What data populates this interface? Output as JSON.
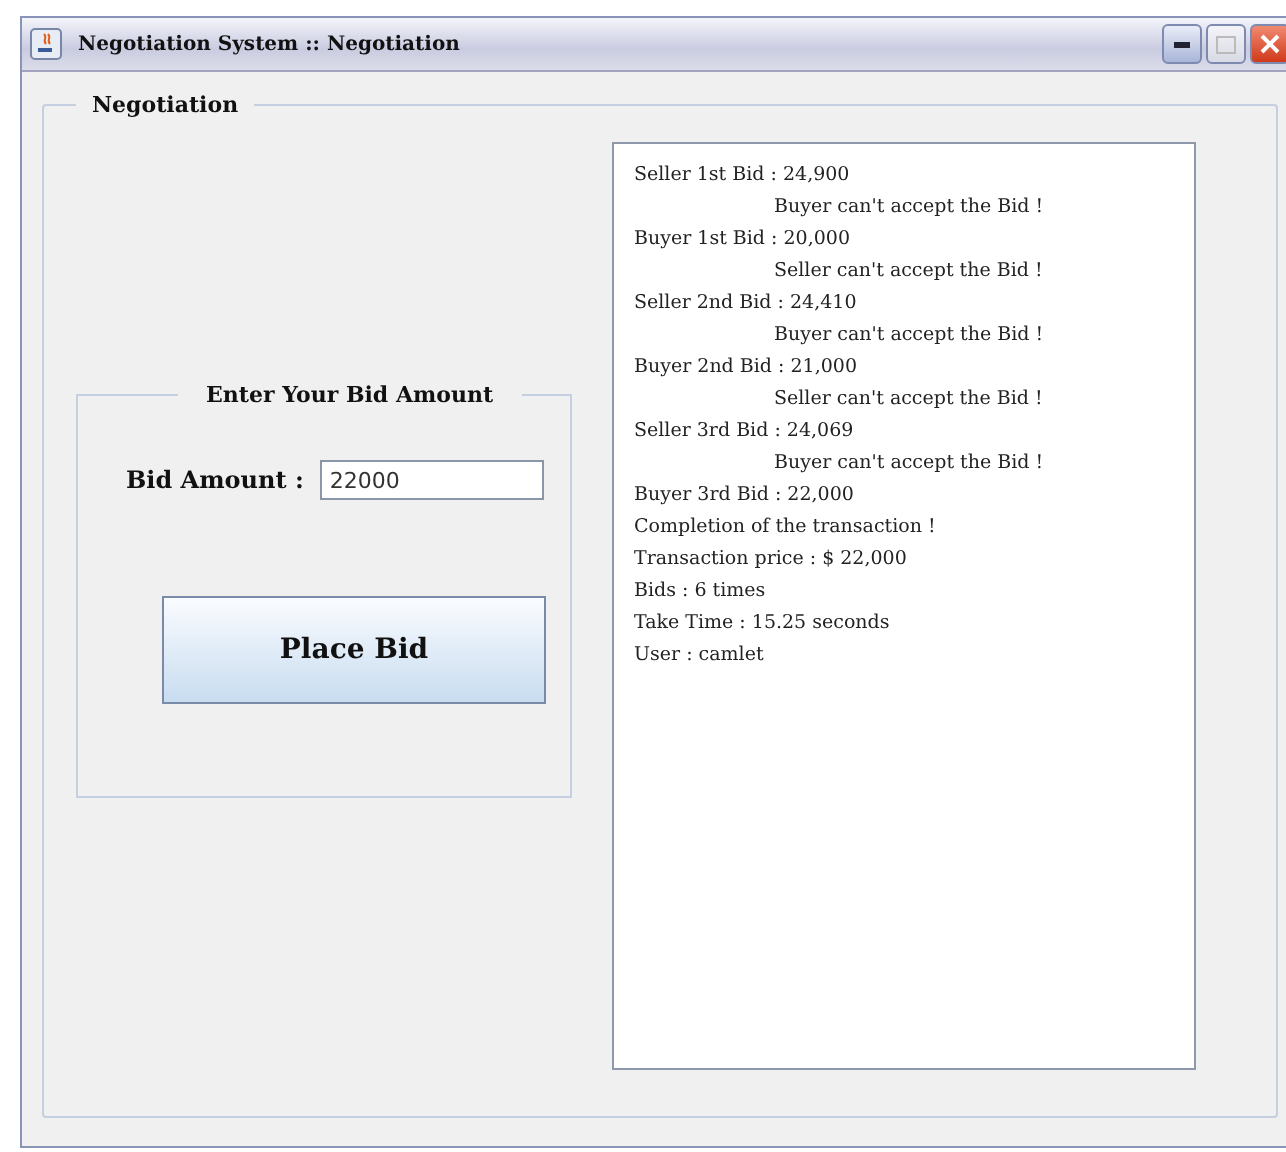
{
  "window": {
    "title": "Negotiation System ::  Negotiation"
  },
  "panel": {
    "title": "Negotiation"
  },
  "bid_group": {
    "title": "Enter Your Bid Amount",
    "label": "Bid Amount :",
    "value": "22000",
    "button": "Place Bid"
  },
  "log": [
    {
      "kind": "bid",
      "text": "Seller 1st Bid : 24,900"
    },
    {
      "kind": "reply",
      "text": "Buyer can't accept the Bid !"
    },
    {
      "kind": "bid",
      "text": "Buyer 1st Bid : 20,000"
    },
    {
      "kind": "reply",
      "text": "Seller can't accept the Bid !"
    },
    {
      "kind": "bid",
      "text": "Seller 2nd Bid : 24,410"
    },
    {
      "kind": "reply",
      "text": "Buyer can't accept the Bid !"
    },
    {
      "kind": "bid",
      "text": "Buyer 2nd Bid : 21,000"
    },
    {
      "kind": "reply",
      "text": "Seller can't accept the Bid !"
    },
    {
      "kind": "bid",
      "text": "Seller 3rd Bid : 24,069"
    },
    {
      "kind": "reply",
      "text": "Buyer can't accept the Bid !"
    },
    {
      "kind": "bid",
      "text": "Buyer 3rd Bid : 22,000"
    },
    {
      "kind": "bid",
      "text": "Completion of the transaction !"
    },
    {
      "kind": "bid",
      "text": "Transaction price : $ 22,000"
    },
    {
      "kind": "bid",
      "text": "Bids : 6 times"
    },
    {
      "kind": "bid",
      "text": "Take Time : 15.25 seconds"
    },
    {
      "kind": "bid",
      "text": "User : camlet"
    }
  ]
}
